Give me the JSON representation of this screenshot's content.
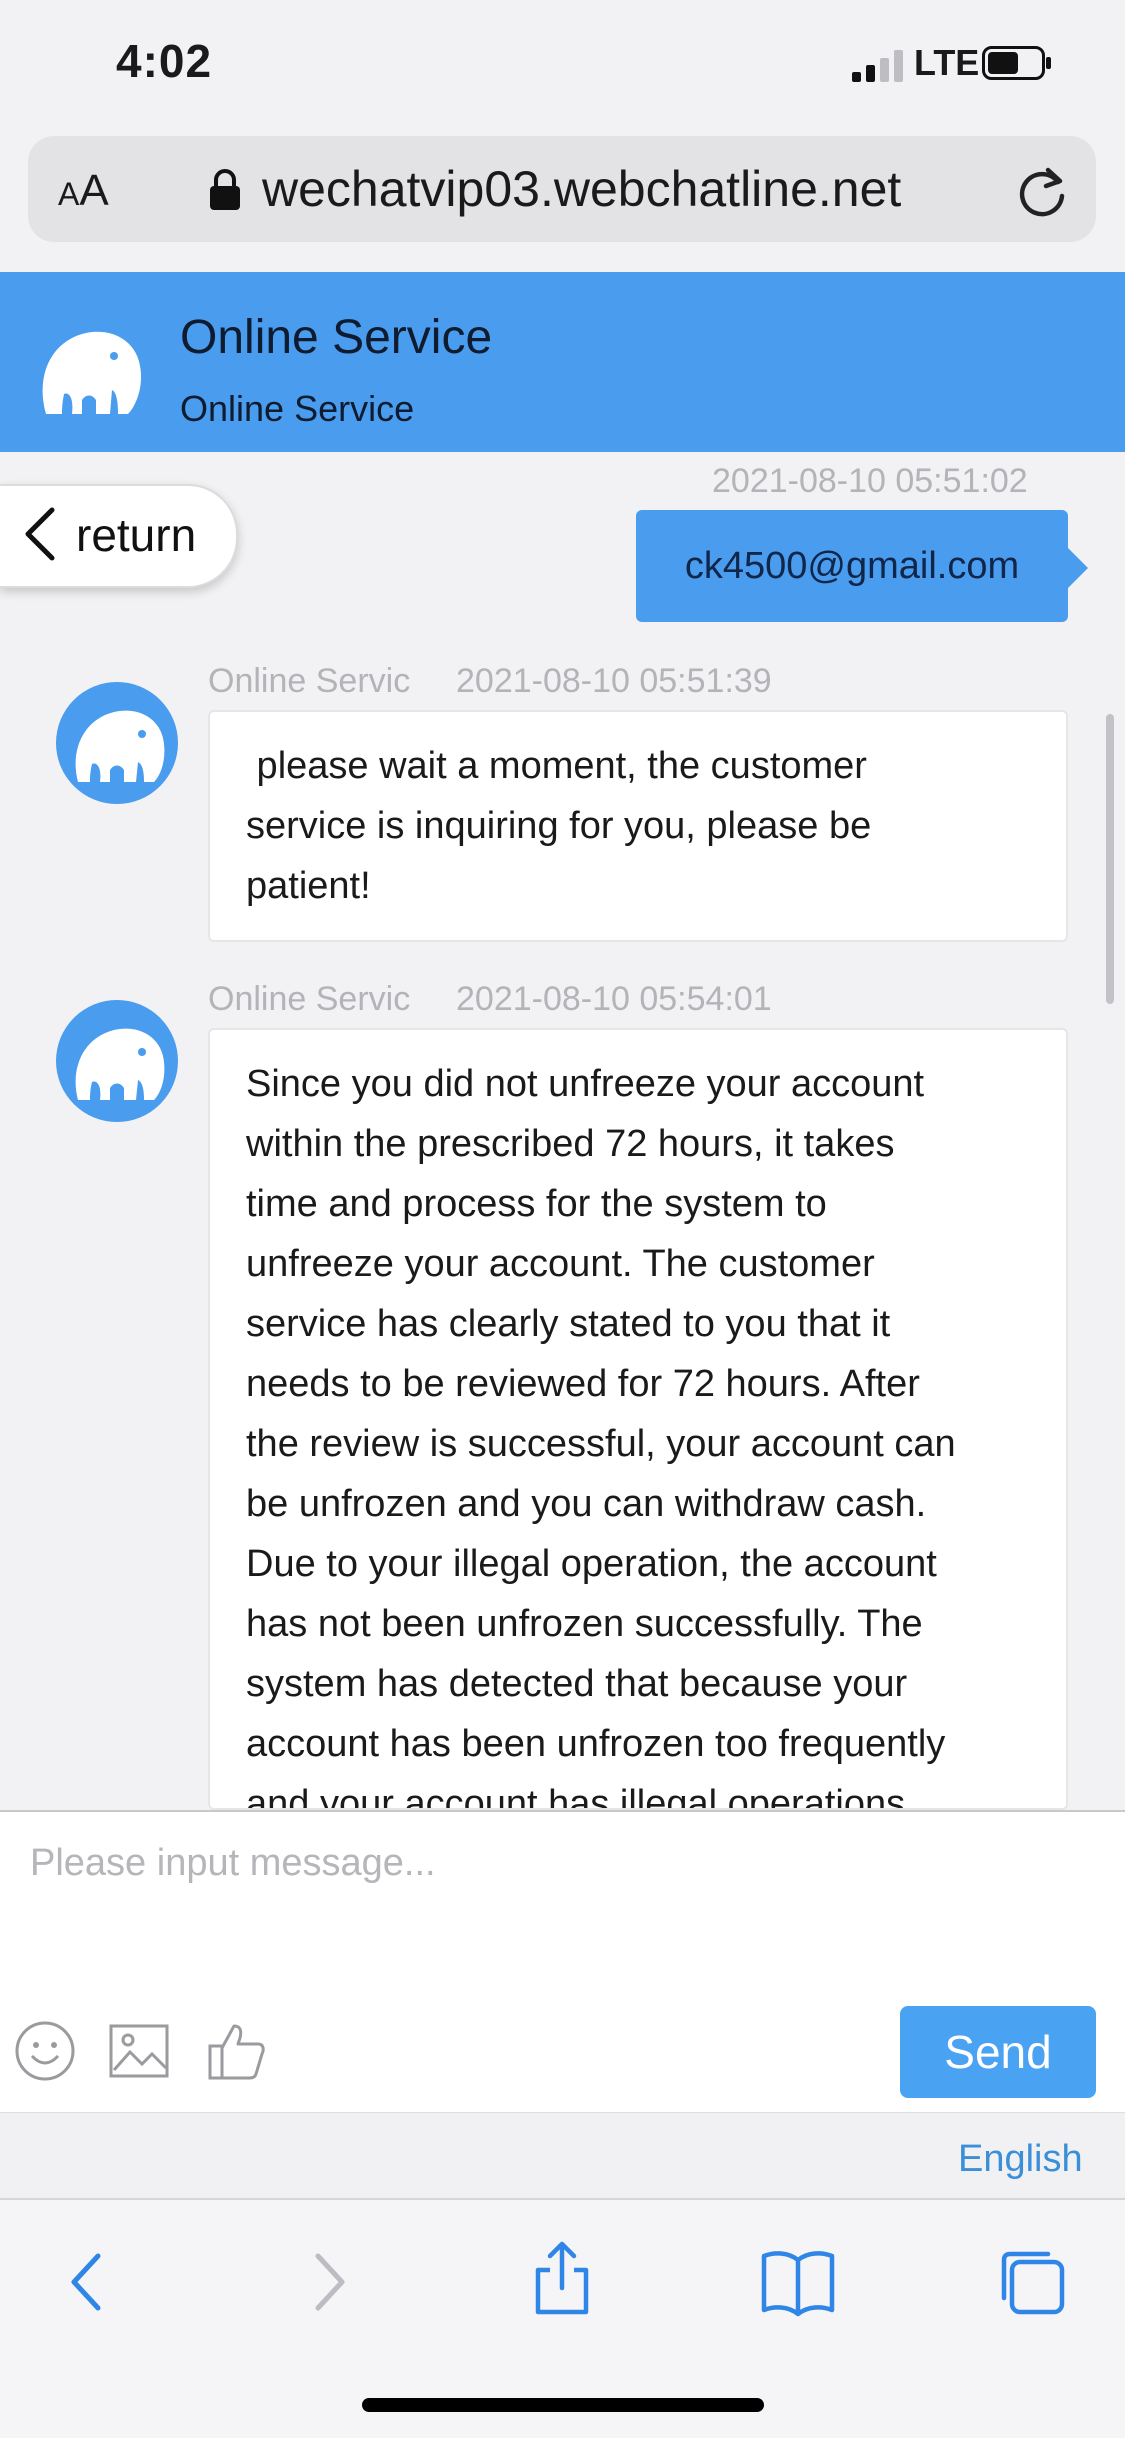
{
  "status_bar": {
    "time": "4:02",
    "network": "LTE"
  },
  "browser": {
    "text_size_label_small": "A",
    "text_size_label_large": "A",
    "url": "wechatvip03.webchatline.net"
  },
  "chat_header": {
    "title": "Online Service",
    "subtitle": "Online Service"
  },
  "nav": {
    "return_label": "return"
  },
  "messages": [
    {
      "direction": "out",
      "timestamp": "2021-08-10 05:51:02",
      "text": "ck4500@gmail.com"
    },
    {
      "direction": "in",
      "sender": "Online Servic",
      "timestamp": "2021-08-10 05:51:39",
      "lines": [
        " please wait a moment, the customer",
        "service is inquiring for you, please be",
        "patient!"
      ]
    },
    {
      "direction": "in",
      "sender": "Online Servic",
      "timestamp": "2021-08-10 05:54:01",
      "lines": [
        "Since you did not unfreeze your account",
        "within the prescribed 72 hours, it takes",
        "time and process for the system to",
        "unfreeze your account. The customer",
        "service has clearly stated to you that it",
        "needs to be reviewed for 72 hours. After",
        "the review is successful, your account can",
        "be unfrozen and you can withdraw cash.",
        "Due to your illegal operation, the account",
        "has not been unfrozen successfully. The",
        "system has detected that because your",
        "account has been unfrozen too frequently",
        "and your account has illegal operations"
      ]
    }
  ],
  "composer": {
    "placeholder": "Please input message...",
    "send_label": "Send",
    "language": "English"
  },
  "colors": {
    "accent": "#4a9cee",
    "send": "#4aa3f2",
    "language_link": "#3a8fd8"
  }
}
